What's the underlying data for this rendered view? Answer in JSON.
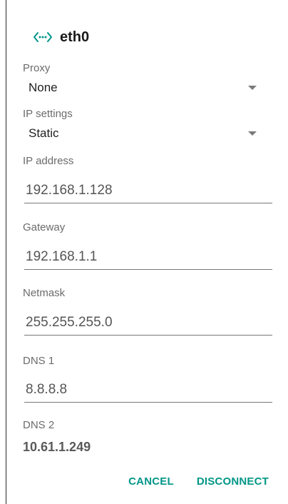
{
  "dialog": {
    "title": "eth0",
    "icon": "ethernet-arrows-icon",
    "accent_color": "#009688"
  },
  "proxy": {
    "label": "Proxy",
    "value": "None"
  },
  "ip_settings": {
    "label": "IP settings",
    "value": "Static"
  },
  "ip_address": {
    "label": "IP address",
    "value": "192.168.1.128"
  },
  "gateway": {
    "label": "Gateway",
    "value": "192.168.1.1"
  },
  "netmask": {
    "label": "Netmask",
    "value": "255.255.255.0"
  },
  "dns1": {
    "label": "DNS 1",
    "value": "8.8.8.8"
  },
  "dns2": {
    "label": "DNS 2",
    "value": "10.61.1.249"
  },
  "actions": {
    "cancel_label": "CANCEL",
    "disconnect_label": "DISCONNECT"
  }
}
